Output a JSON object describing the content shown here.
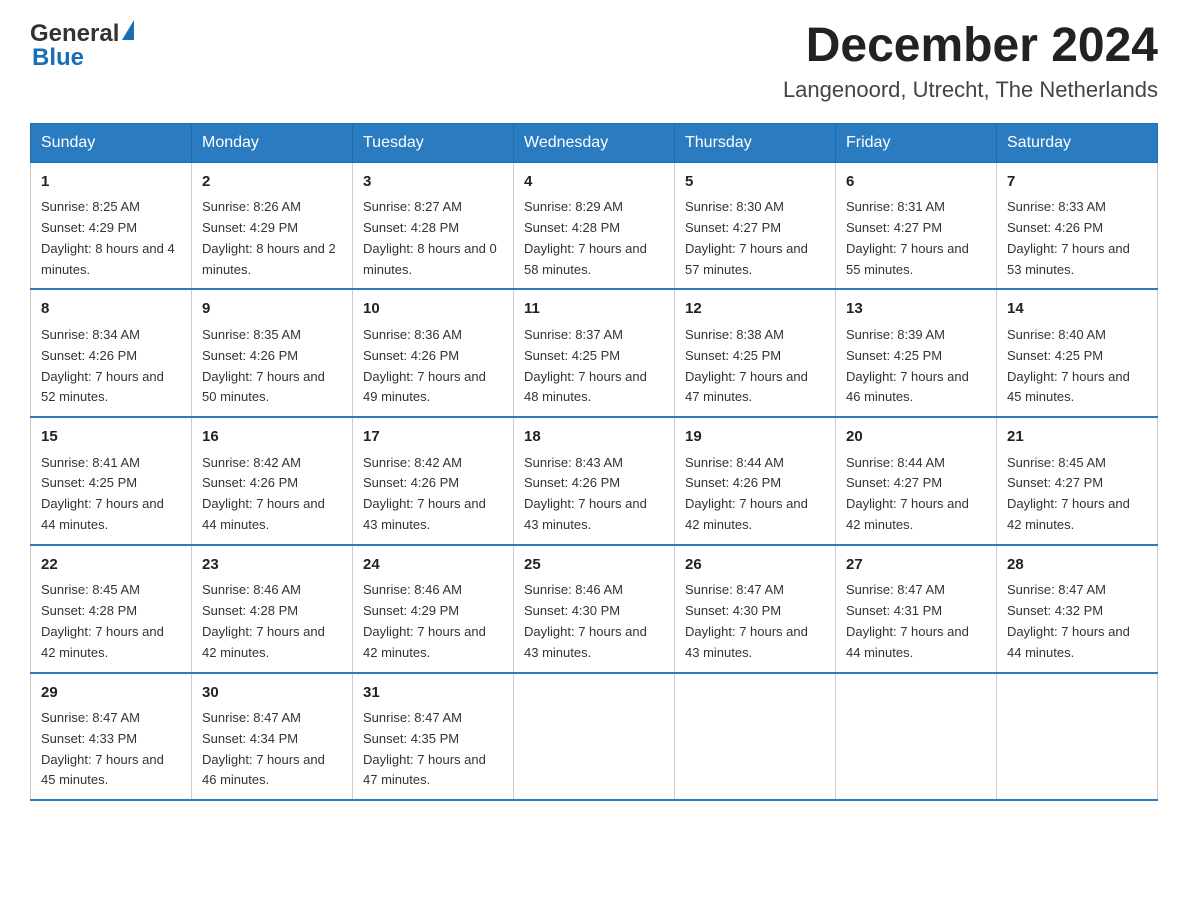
{
  "header": {
    "logo_general": "General",
    "logo_blue": "Blue",
    "month_title": "December 2024",
    "location": "Langenoord, Utrecht, The Netherlands"
  },
  "days_of_week": [
    "Sunday",
    "Monday",
    "Tuesday",
    "Wednesday",
    "Thursday",
    "Friday",
    "Saturday"
  ],
  "weeks": [
    [
      {
        "day": "1",
        "sunrise": "8:25 AM",
        "sunset": "4:29 PM",
        "daylight": "8 hours and 4 minutes."
      },
      {
        "day": "2",
        "sunrise": "8:26 AM",
        "sunset": "4:29 PM",
        "daylight": "8 hours and 2 minutes."
      },
      {
        "day": "3",
        "sunrise": "8:27 AM",
        "sunset": "4:28 PM",
        "daylight": "8 hours and 0 minutes."
      },
      {
        "day": "4",
        "sunrise": "8:29 AM",
        "sunset": "4:28 PM",
        "daylight": "7 hours and 58 minutes."
      },
      {
        "day": "5",
        "sunrise": "8:30 AM",
        "sunset": "4:27 PM",
        "daylight": "7 hours and 57 minutes."
      },
      {
        "day": "6",
        "sunrise": "8:31 AM",
        "sunset": "4:27 PM",
        "daylight": "7 hours and 55 minutes."
      },
      {
        "day": "7",
        "sunrise": "8:33 AM",
        "sunset": "4:26 PM",
        "daylight": "7 hours and 53 minutes."
      }
    ],
    [
      {
        "day": "8",
        "sunrise": "8:34 AM",
        "sunset": "4:26 PM",
        "daylight": "7 hours and 52 minutes."
      },
      {
        "day": "9",
        "sunrise": "8:35 AM",
        "sunset": "4:26 PM",
        "daylight": "7 hours and 50 minutes."
      },
      {
        "day": "10",
        "sunrise": "8:36 AM",
        "sunset": "4:26 PM",
        "daylight": "7 hours and 49 minutes."
      },
      {
        "day": "11",
        "sunrise": "8:37 AM",
        "sunset": "4:25 PM",
        "daylight": "7 hours and 48 minutes."
      },
      {
        "day": "12",
        "sunrise": "8:38 AM",
        "sunset": "4:25 PM",
        "daylight": "7 hours and 47 minutes."
      },
      {
        "day": "13",
        "sunrise": "8:39 AM",
        "sunset": "4:25 PM",
        "daylight": "7 hours and 46 minutes."
      },
      {
        "day": "14",
        "sunrise": "8:40 AM",
        "sunset": "4:25 PM",
        "daylight": "7 hours and 45 minutes."
      }
    ],
    [
      {
        "day": "15",
        "sunrise": "8:41 AM",
        "sunset": "4:25 PM",
        "daylight": "7 hours and 44 minutes."
      },
      {
        "day": "16",
        "sunrise": "8:42 AM",
        "sunset": "4:26 PM",
        "daylight": "7 hours and 44 minutes."
      },
      {
        "day": "17",
        "sunrise": "8:42 AM",
        "sunset": "4:26 PM",
        "daylight": "7 hours and 43 minutes."
      },
      {
        "day": "18",
        "sunrise": "8:43 AM",
        "sunset": "4:26 PM",
        "daylight": "7 hours and 43 minutes."
      },
      {
        "day": "19",
        "sunrise": "8:44 AM",
        "sunset": "4:26 PM",
        "daylight": "7 hours and 42 minutes."
      },
      {
        "day": "20",
        "sunrise": "8:44 AM",
        "sunset": "4:27 PM",
        "daylight": "7 hours and 42 minutes."
      },
      {
        "day": "21",
        "sunrise": "8:45 AM",
        "sunset": "4:27 PM",
        "daylight": "7 hours and 42 minutes."
      }
    ],
    [
      {
        "day": "22",
        "sunrise": "8:45 AM",
        "sunset": "4:28 PM",
        "daylight": "7 hours and 42 minutes."
      },
      {
        "day": "23",
        "sunrise": "8:46 AM",
        "sunset": "4:28 PM",
        "daylight": "7 hours and 42 minutes."
      },
      {
        "day": "24",
        "sunrise": "8:46 AM",
        "sunset": "4:29 PM",
        "daylight": "7 hours and 42 minutes."
      },
      {
        "day": "25",
        "sunrise": "8:46 AM",
        "sunset": "4:30 PM",
        "daylight": "7 hours and 43 minutes."
      },
      {
        "day": "26",
        "sunrise": "8:47 AM",
        "sunset": "4:30 PM",
        "daylight": "7 hours and 43 minutes."
      },
      {
        "day": "27",
        "sunrise": "8:47 AM",
        "sunset": "4:31 PM",
        "daylight": "7 hours and 44 minutes."
      },
      {
        "day": "28",
        "sunrise": "8:47 AM",
        "sunset": "4:32 PM",
        "daylight": "7 hours and 44 minutes."
      }
    ],
    [
      {
        "day": "29",
        "sunrise": "8:47 AM",
        "sunset": "4:33 PM",
        "daylight": "7 hours and 45 minutes."
      },
      {
        "day": "30",
        "sunrise": "8:47 AM",
        "sunset": "4:34 PM",
        "daylight": "7 hours and 46 minutes."
      },
      {
        "day": "31",
        "sunrise": "8:47 AM",
        "sunset": "4:35 PM",
        "daylight": "7 hours and 47 minutes."
      },
      null,
      null,
      null,
      null
    ]
  ]
}
